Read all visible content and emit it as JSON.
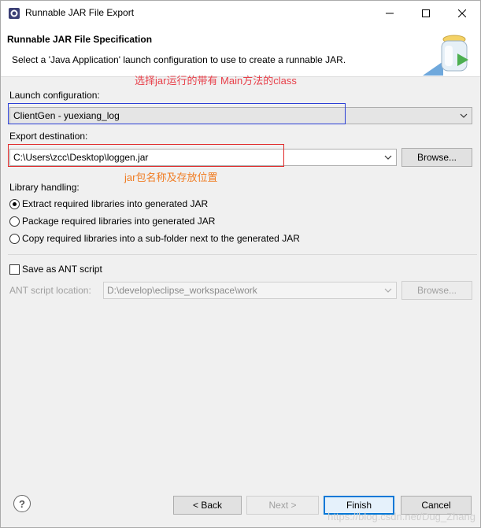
{
  "window": {
    "title": "Runnable JAR File Export",
    "controls": {
      "minimize_icon": "minimize-icon",
      "maximize_icon": "maximize-icon",
      "close_icon": "close-icon"
    }
  },
  "header": {
    "title": "Runnable JAR File Specification",
    "description": "Select a 'Java Application' launch configuration to use to create a runnable JAR."
  },
  "annotations": {
    "launch_note": "选择jar运行的带有 Main方法的class",
    "export_note": "jar包名称及存放位置"
  },
  "launch": {
    "label": "Launch configuration:",
    "value": "ClientGen - yuexiang_log"
  },
  "export": {
    "label": "Export destination:",
    "value": "C:\\Users\\zcc\\Desktop\\loggen.jar",
    "browse": "Browse..."
  },
  "library": {
    "label": "Library handling:",
    "options": [
      {
        "label": "Extract required libraries into generated JAR",
        "checked": true
      },
      {
        "label": "Package required libraries into generated JAR",
        "checked": false
      },
      {
        "label": "Copy required libraries into a sub-folder next to the generated JAR",
        "checked": false
      }
    ]
  },
  "ant": {
    "save_label": "Save as ANT script",
    "location_label": "ANT script location:",
    "location_value": "D:\\develop\\eclipse_workspace\\work",
    "browse": "Browse..."
  },
  "footer": {
    "back": "< Back",
    "next": "Next >",
    "finish": "Finish",
    "cancel": "Cancel",
    "help": "?"
  },
  "watermark": "https://blog.csdn.net/Dug_Zhang"
}
